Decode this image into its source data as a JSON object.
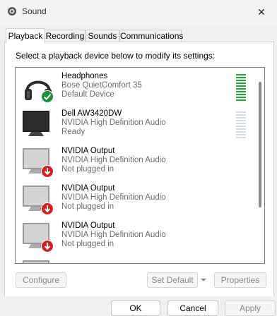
{
  "window": {
    "title": "Sound",
    "close_glyph": "✕"
  },
  "tabs": [
    {
      "label": "Playback",
      "active": true
    },
    {
      "label": "Recording",
      "active": false
    },
    {
      "label": "Sounds",
      "active": false
    },
    {
      "label": "Communications",
      "active": false
    }
  ],
  "instruction": "Select a playback device below to modify its settings:",
  "devices": [
    {
      "name": "Headphones",
      "driver": "Bose QuietComfort 35",
      "status": "Default Device",
      "icon": "headphones-icon",
      "badge": "default-check-badge",
      "meter_level": 1.0
    },
    {
      "name": "Dell AW3420DW",
      "driver": "NVIDIA High Definition Audio",
      "status": "Ready",
      "icon": "monitor-icon",
      "meter_level": 0.0
    },
    {
      "name": "NVIDIA Output",
      "driver": "NVIDIA High Definition Audio",
      "status": "Not plugged in",
      "icon": "monitor-icon",
      "badge": "unplugged-badge"
    },
    {
      "name": "NVIDIA Output",
      "driver": "NVIDIA High Definition Audio",
      "status": "Not plugged in",
      "icon": "monitor-icon",
      "badge": "unplugged-badge"
    },
    {
      "name": "NVIDIA Output",
      "driver": "NVIDIA High Definition Audio",
      "status": "Not plugged in",
      "icon": "monitor-icon",
      "badge": "unplugged-badge"
    }
  ],
  "buttons": {
    "configure": "Configure",
    "set_default": "Set Default",
    "properties": "Properties",
    "ok": "OK",
    "cancel": "Cancel",
    "apply": "Apply"
  },
  "colors": {
    "meter_active": "#1da832",
    "default_badge": "#1e8e3e",
    "unplugged_badge": "#d42020"
  }
}
